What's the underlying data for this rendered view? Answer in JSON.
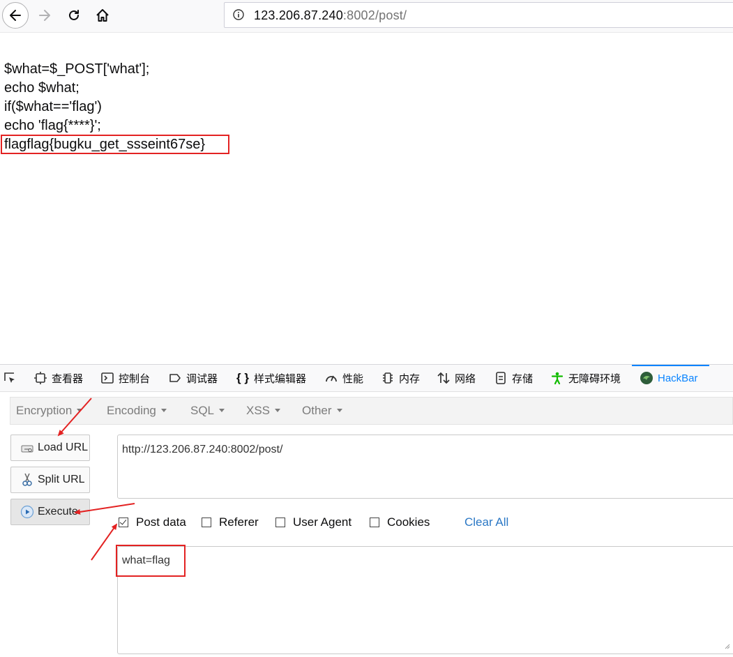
{
  "browser": {
    "url_host": "123.206.87.240",
    "url_rest": ":8002/post/"
  },
  "page": {
    "code_lines": [
      "$what=$_POST['what'];",
      "echo $what;",
      "if($what=='flag')",
      "echo 'flag{****}';"
    ],
    "output_line": "flagflag{bugku_get_ssseint67se}"
  },
  "devtools": {
    "tabs": [
      {
        "label": "查看器",
        "icon": "inspector-icon"
      },
      {
        "label": "控制台",
        "icon": "console-icon"
      },
      {
        "label": "调试器",
        "icon": "debugger-icon"
      },
      {
        "label": "样式编辑器",
        "icon": "style-editor-icon"
      },
      {
        "label": "性能",
        "icon": "performance-icon"
      },
      {
        "label": "内存",
        "icon": "memory-icon"
      },
      {
        "label": "网络",
        "icon": "network-icon"
      },
      {
        "label": "存储",
        "icon": "storage-icon"
      },
      {
        "label": "无障碍环境",
        "icon": "accessibility-icon"
      },
      {
        "label": "HackBar",
        "icon": "hackbar-icon",
        "active": true
      }
    ]
  },
  "hackbar": {
    "menus": [
      "Encryption",
      "Encoding",
      "SQL",
      "XSS",
      "Other"
    ],
    "buttons": {
      "load_url": "Load URL",
      "split_url": "Split URL",
      "execute": "Execute"
    },
    "url_value": "http://123.206.87.240:8002/post/",
    "options": {
      "post_data": {
        "label": "Post data",
        "checked": true
      },
      "referer": {
        "label": "Referer",
        "checked": false
      },
      "user_agent": {
        "label": "User Agent",
        "checked": false
      },
      "cookies": {
        "label": "Cookies",
        "checked": false
      }
    },
    "clear_all": "Clear All",
    "post_value": "what=flag"
  },
  "colors": {
    "annotation_red": "#e32222",
    "hackbar_blue": "#0a84ff",
    "link_blue": "#2b78c5"
  }
}
